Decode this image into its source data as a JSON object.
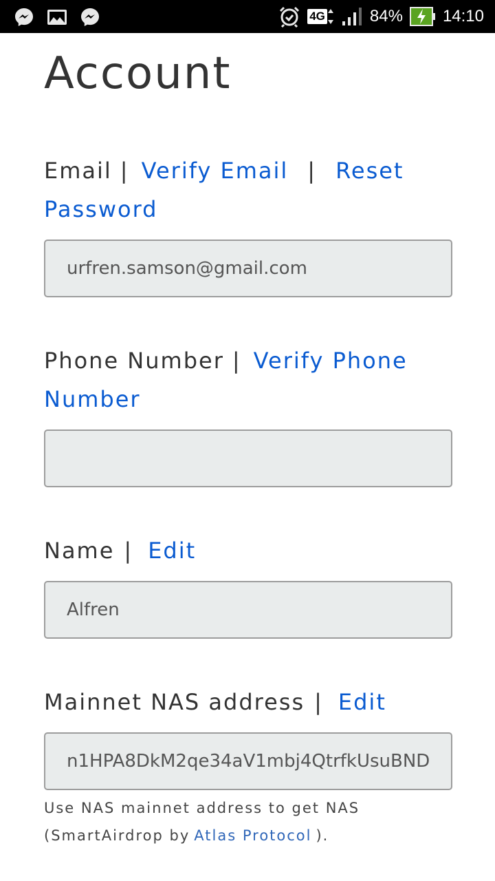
{
  "status_bar": {
    "left_icons": [
      "messenger-icon",
      "gallery-icon",
      "messenger-icon"
    ],
    "alarm_icon": "alarm-icon",
    "network": "4G",
    "signal_icon": "signal-icon",
    "battery_percent": "84%",
    "battery_icon": "battery-charging-icon",
    "time": "14:10"
  },
  "page": {
    "title": "Account"
  },
  "email": {
    "label": "Email",
    "separator": "|",
    "verify_link": "Verify Email",
    "reset_link_line1": "Reset",
    "reset_link_line2": "Password",
    "value": "urfren.samson@gmail.com"
  },
  "phone": {
    "label": "Phone Number",
    "separator": "|",
    "verify_link_line1": "Verify Phone",
    "verify_link_line2": "Number",
    "value": ""
  },
  "name": {
    "label": "Name",
    "separator": "|",
    "edit_link": "Edit",
    "value": "Alfren"
  },
  "nas": {
    "label": "Mainnet NAS address",
    "separator": "|",
    "edit_link": "Edit",
    "value": "n1HPA8DkM2qe34aV1mbj4QtrfkUsuBND",
    "help_text_line1": "Use NAS mainnet address to get NAS",
    "help_text_prefix": "(SmartAirdrop by",
    "help_link": "Atlas Protocol",
    "help_text_suffix": ")."
  },
  "colors": {
    "link": "#0a5bd1",
    "text": "#333333",
    "field_bg": "#e9ecec",
    "field_border": "#9c9c9c"
  }
}
